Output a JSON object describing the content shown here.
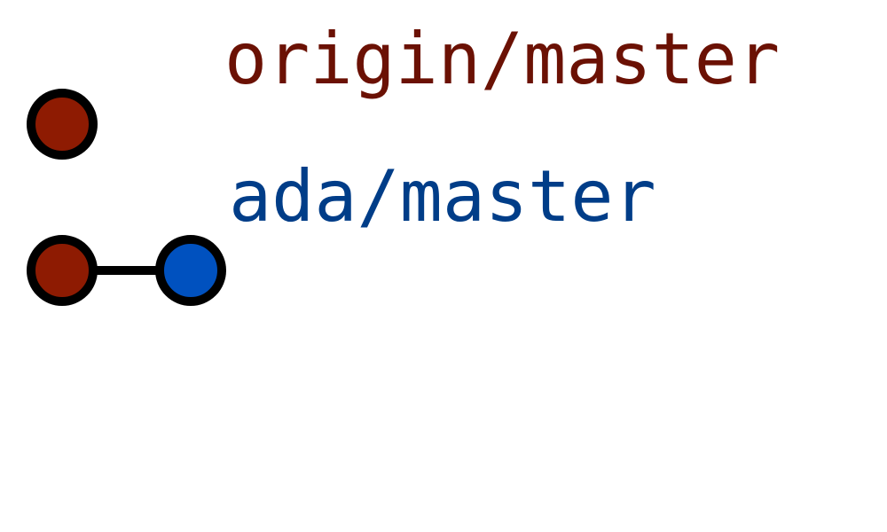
{
  "branches": [
    {
      "label": "origin/master",
      "color": "#6b1104",
      "commits": [
        {
          "fill": "#8e1b02"
        }
      ]
    },
    {
      "label": "ada/master",
      "color": "#003d88",
      "commits": [
        {
          "fill": "#8e1b02"
        },
        {
          "fill": "#0051bf"
        }
      ]
    }
  ],
  "commit_outline": "#000000",
  "connector_color": "#000000"
}
